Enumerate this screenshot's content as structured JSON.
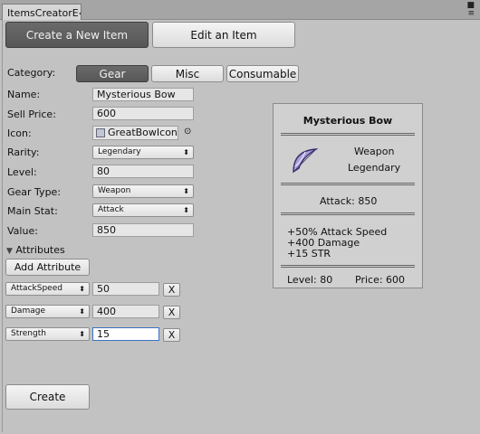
{
  "window": {
    "tab_title": "ItemsCreatorE‹"
  },
  "mode_tabs": {
    "create": "Create a New Item",
    "edit": "Edit an Item"
  },
  "form": {
    "category_label": "Category:",
    "categories": [
      "Gear",
      "Misc",
      "Consumable"
    ],
    "selected_category": "Gear",
    "name_label": "Name:",
    "name_value": "Mysterious Bow",
    "sell_price_label": "Sell Price:",
    "sell_price_value": "600",
    "icon_label": "Icon:",
    "icon_value": "GreatBowIcon",
    "rarity_label": "Rarity:",
    "rarity_value": "Legendary",
    "level_label": "Level:",
    "level_value": "80",
    "gear_type_label": "Gear Type:",
    "gear_type_value": "Weapon",
    "main_stat_label": "Main Stat:",
    "main_stat_value": "Attack",
    "value_label": "Value:",
    "value_value": "850",
    "attributes_label": "Attributes",
    "add_attribute_label": "Add Attribute",
    "attributes": [
      {
        "stat": "AttackSpeed",
        "value": "50"
      },
      {
        "stat": "Damage",
        "value": "400"
      },
      {
        "stat": "Strength",
        "value": "15"
      }
    ],
    "remove_label": "X",
    "create_label": "Create"
  },
  "preview": {
    "title": "Mysterious Bow",
    "type": "Weapon",
    "rarity": "Legendary",
    "main_stat_line": "Attack: 850",
    "attribute_lines": [
      "+50% Attack Speed",
      "+400 Damage",
      "+15 STR"
    ],
    "level_text": "Level: 80",
    "price_text": "Price: 600"
  },
  "icons": {
    "bow": "bow-icon",
    "picker": "object-picker-icon",
    "foldout": "foldout-arrow-icon"
  },
  "colors": {
    "selected_tab": "#5f5f5f",
    "background": "#c2c2c2",
    "focus_border": "#3d72c4"
  }
}
